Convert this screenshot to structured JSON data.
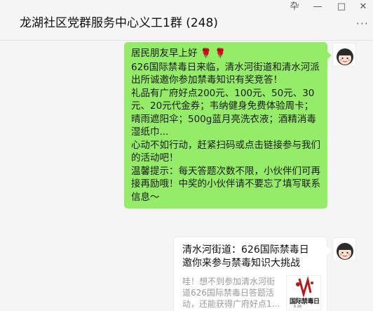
{
  "window": {
    "title": "龙湖社区党群服务中心义工1群 (248)",
    "pin_icon": "卆",
    "minimize_icon": "—",
    "maximize_icon": "□",
    "close_icon": "✕",
    "more_icon": "···"
  },
  "messages": [
    {
      "type": "text",
      "greeting": "居民朋友早上好",
      "emoji": "🌹 🌹",
      "body": "626国际禁毒日来临，清水河街道和清水河派出所诚邀你参加禁毒知识有奖竞答！\n礼品有广府好点200元、100元、50元、30元、20元代金券；韦纳健身免费体验周卡；晴雨遮阳伞；500g蓝月亮洗衣液；酒精消毒湿纸巾...\n心动不如行动，赶紧扫码或点击链接参与我们的活动吧！\n温馨提示：每天答题次数不限，小伙伴们可再接再励哦！中奖的小伙伴请不要忘了填写联系信息～"
    },
    {
      "type": "link",
      "title": "清水河街道：626国际禁毒日邀你来参与禁毒知识大挑战",
      "description": "哇！想不到参加清水河街道626国际禁毒日答题活动，还能获得广府好点1...",
      "thumb_text": "国际禁毒日",
      "thumb_sub": "6.26"
    }
  ],
  "colors": {
    "self_bubble": "#95ec69",
    "background": "#f5f5f5",
    "card": "#ffffff"
  }
}
